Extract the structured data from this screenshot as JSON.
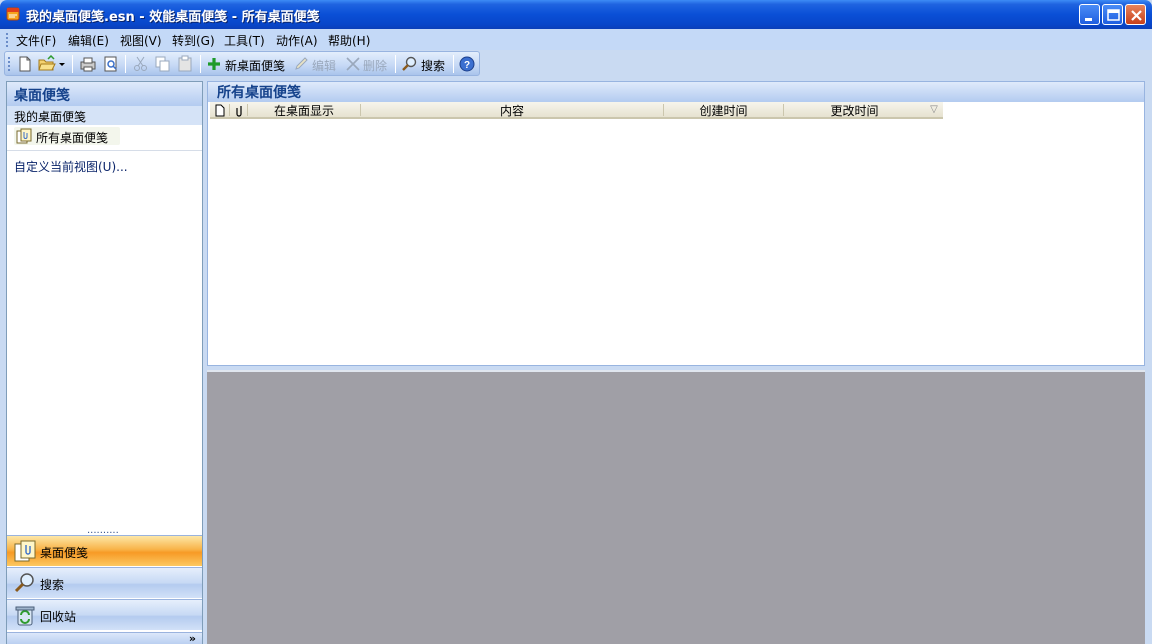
{
  "window": {
    "title": "我的桌面便笺.esn - 效能桌面便笺 - 所有桌面便笺"
  },
  "menu": [
    {
      "label": "文件(F)"
    },
    {
      "label": "编辑(E)"
    },
    {
      "label": "视图(V)"
    },
    {
      "label": "转到(G)"
    },
    {
      "label": "工具(T)"
    },
    {
      "label": "动作(A)"
    },
    {
      "label": "帮助(H)"
    }
  ],
  "toolbar": {
    "new_note_label": "新桌面便笺",
    "edit_label": "编辑",
    "delete_label": "删除",
    "search_label": "搜索"
  },
  "nav": {
    "header": "桌面便笺",
    "section": "我的桌面便笺",
    "selected_item": "所有桌面便笺",
    "customize_link": "自定义当前视图(U)...",
    "splitter": "..........",
    "buttons": [
      {
        "label": "桌面便笺",
        "icon": "note-folder-icon"
      },
      {
        "label": "搜索",
        "icon": "search-icon"
      },
      {
        "label": "回收站",
        "icon": "recycle-bin-icon"
      }
    ],
    "expand_chevron": "»"
  },
  "main": {
    "header": "所有桌面便笺",
    "columns": [
      "在桌面显示",
      "内容",
      "创建时间",
      "更改时间"
    ],
    "sort_indicator": "▽",
    "rows": []
  }
}
